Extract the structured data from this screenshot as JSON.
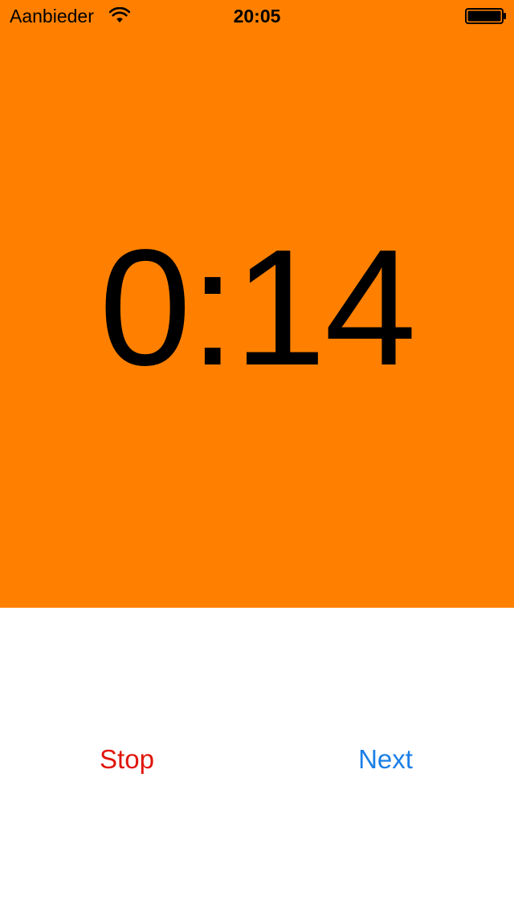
{
  "status_bar": {
    "carrier": "Aanbieder",
    "time": "20:05",
    "wifi_icon": "wifi-icon",
    "battery_icon": "battery-icon",
    "battery_level": 1.0
  },
  "timer": {
    "value": "0:14",
    "background_color": "#ff8000"
  },
  "actions": {
    "stop_label": "Stop",
    "stop_color": "#e0140a",
    "next_label": "Next",
    "next_color": "#1a7fe6"
  }
}
